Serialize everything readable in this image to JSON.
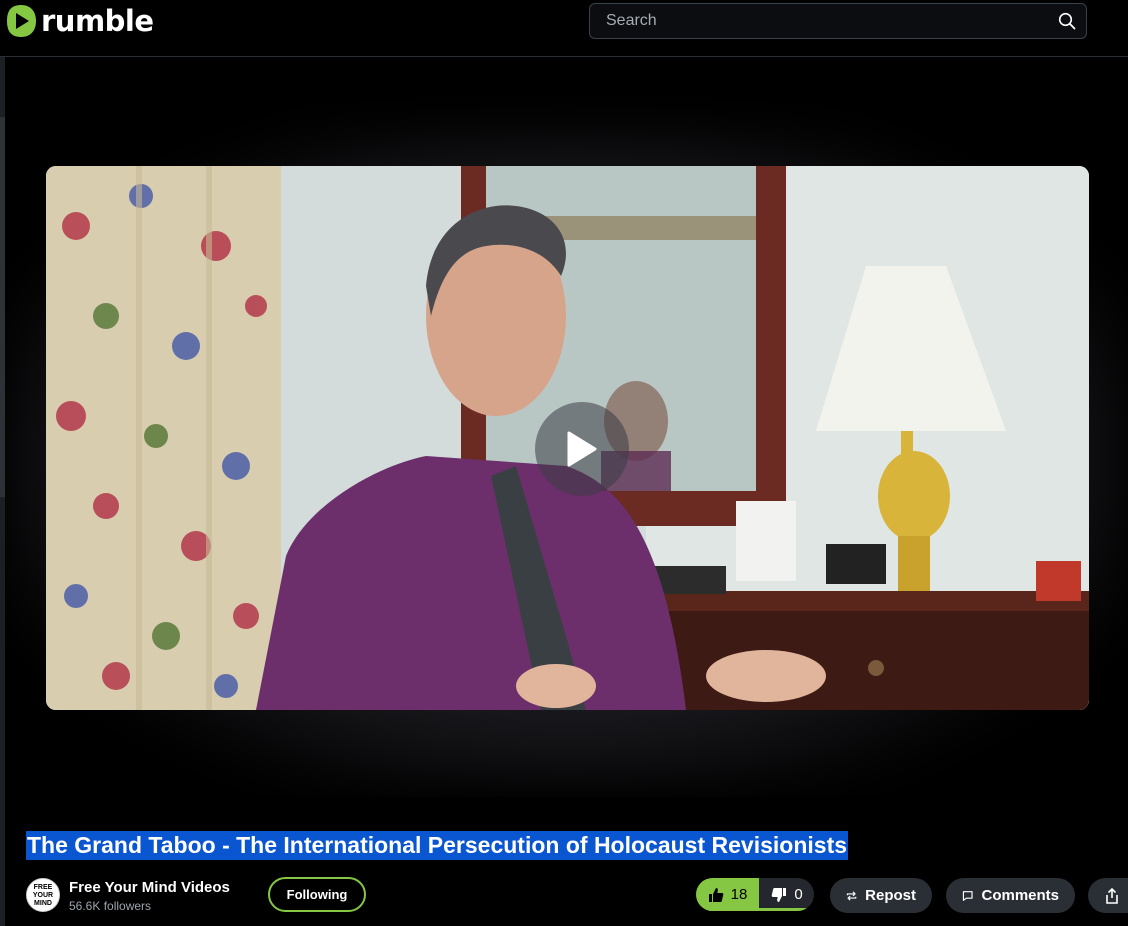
{
  "header": {
    "logo_text": "rumble",
    "brand_color": "#85c742",
    "search": {
      "placeholder": "Search",
      "icon": "search-icon"
    }
  },
  "video": {
    "play_icon": "play-icon",
    "title": "The Grand Taboo - The International Persecution of Holocaust Revisionists"
  },
  "channel": {
    "avatar_text": "FREE YOUR MIND",
    "name": "Free Your Mind Videos",
    "followers": "56.6K followers",
    "follow_label": "Following"
  },
  "actions": {
    "likes": "18",
    "dislikes": "0",
    "repost_label": "Repost",
    "comments_label": "Comments"
  }
}
